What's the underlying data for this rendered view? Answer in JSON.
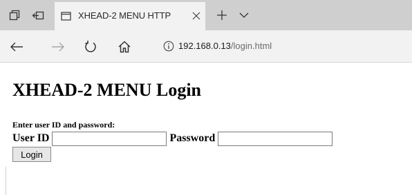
{
  "browser": {
    "tab_title": "XHEAD-2 MENU HTTP",
    "url_host": "192.168.0.13",
    "url_path": "/login.html",
    "icons": {
      "tabs_aside": "tabs-aside-icon",
      "set_aside": "set-tabs-aside-icon",
      "page": "page-icon",
      "close": "close-icon",
      "new_tab": "plus-icon",
      "tab_list": "chevron-down-icon",
      "back": "back-arrow-icon",
      "forward": "forward-arrow-icon",
      "refresh": "refresh-icon",
      "home": "home-icon",
      "info": "info-icon"
    }
  },
  "page": {
    "heading": "XHEAD-2 MENU Login",
    "prompt": "Enter user ID and password:",
    "user_id_label": "User ID",
    "user_id_value": "",
    "password_label": "Password",
    "password_value": "",
    "login_button": "Login"
  }
}
